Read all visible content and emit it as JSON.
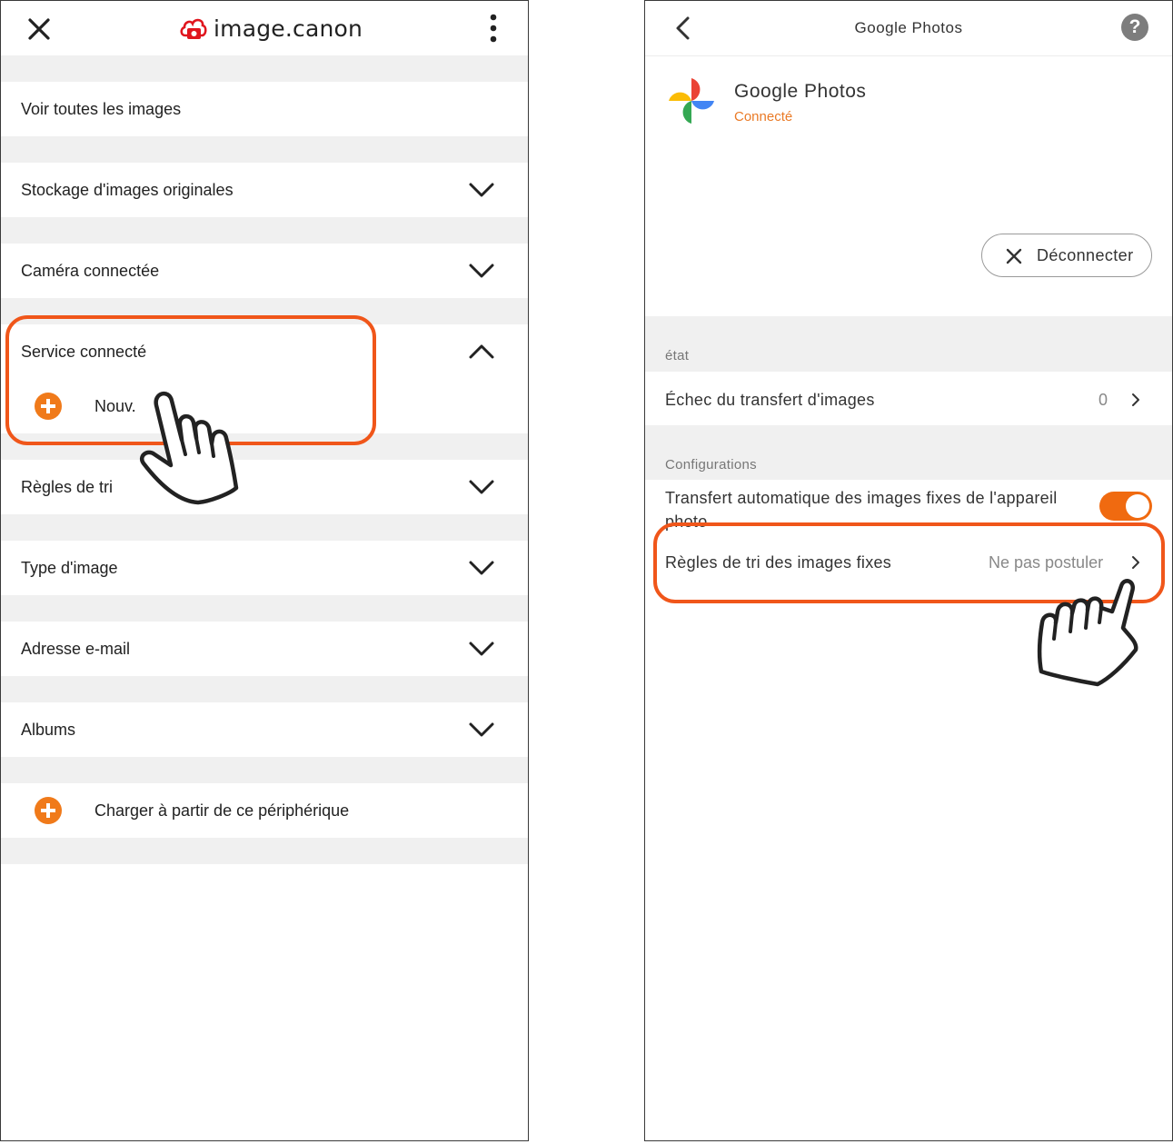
{
  "left": {
    "brand": {
      "name": "image.canon"
    },
    "menu": [
      {
        "label": "Voir toutes les images"
      },
      {
        "label": "Stockage d'images originales"
      },
      {
        "label": "Caméra connectée"
      },
      {
        "label": "Service connecté",
        "sub_label": "Nouv."
      },
      {
        "label": "Règles de tri"
      },
      {
        "label": "Type d'image"
      },
      {
        "label": "Adresse e-mail"
      },
      {
        "label": "Albums"
      },
      {
        "label": "Charger à partir de ce périphérique"
      }
    ],
    "colors": {
      "accent": "#f07a1a",
      "highlight": "#f0561a",
      "brand_red": "#e0161e"
    }
  },
  "right": {
    "header": {
      "title": "Google Photos",
      "help": "?"
    },
    "service": {
      "name": "Google Photos",
      "status": "Connecté"
    },
    "disconnect_label": "Déconnecter",
    "sections": {
      "state": "état",
      "config": "Configurations"
    },
    "rows": {
      "transfer_failure": {
        "label": "Échec du transfert d'images",
        "value": "0"
      },
      "auto_transfer": {
        "label": "Transfert automatique des images fixes de l'appareil photo",
        "enabled": true
      },
      "sort_rules": {
        "label": "Règles de tri des images fixes",
        "value": "Ne pas postuler"
      }
    },
    "colors": {
      "status": "#ea7a26",
      "toggle": "#f06a10"
    }
  }
}
